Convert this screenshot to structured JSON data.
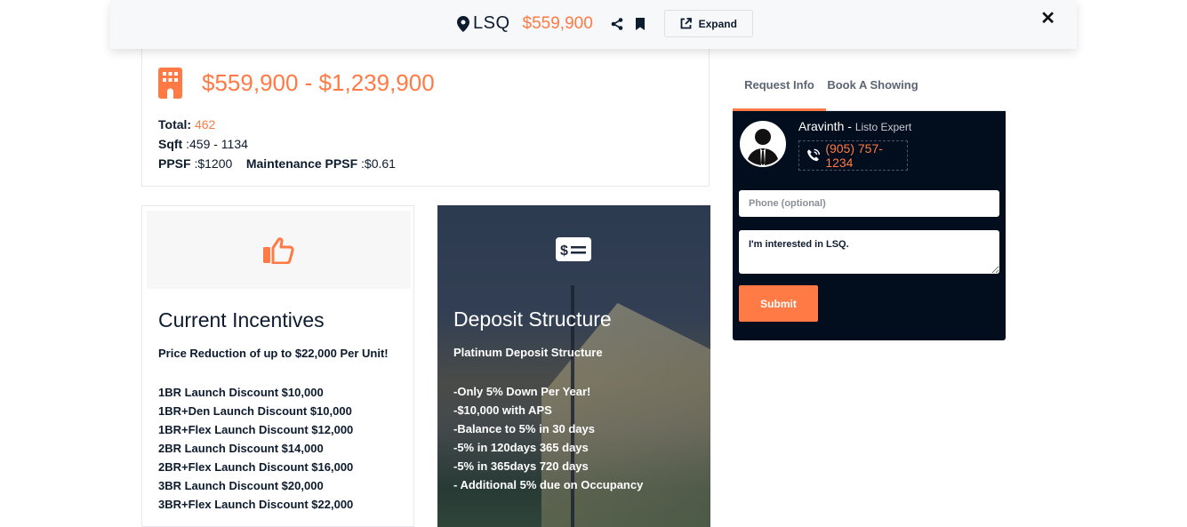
{
  "header": {
    "title": "LSQ",
    "price": "$559,900",
    "expand_label": "Expand",
    "icons": {
      "location": "map-pin-icon",
      "share": "share-icon",
      "bookmark": "bookmark-icon",
      "expand": "external-link-icon",
      "close": "close-icon"
    },
    "close_glyph": "✕"
  },
  "summary": {
    "price_range": "$559,900 - $1,239,900",
    "total_label": "Total:",
    "total_value": "462",
    "sqft_label": "Sqft",
    "sqft_value": ":459 - 1134",
    "ppsf_label": "PPSF",
    "ppsf_value": ":$1200",
    "maint_label": "Maintenance PPSF",
    "maint_value": ":$0.61"
  },
  "incentives": {
    "title": "Current Incentives",
    "subtitle": "Price Reduction of up to $22,000 Per Unit!",
    "items": [
      "1BR Launch Discount $10,000",
      "1BR+Den Launch Discount $10,000",
      "1BR+Flex Launch Discount $12,000",
      "2BR Launch Discount $14,000",
      "2BR+Flex Launch Discount $16,000",
      "3BR Launch Discount $20,000",
      "3BR+Flex Launch Discount $22,000"
    ]
  },
  "deposit": {
    "title": "Deposit Structure",
    "subtitle": "Platinum Deposit Structure",
    "items": [
      "-Only 5% Down Per Year!",
      "-$10,000 with APS",
      "-Balance to 5% in 30 days",
      "-5% in 120days 365 days",
      "-5% in 365days 720 days",
      "- Additional 5% due on Occupancy"
    ]
  },
  "sidebar": {
    "tabs": [
      {
        "label": "Request Info",
        "active": true
      },
      {
        "label": "Book A Showing",
        "active": false
      }
    ],
    "agent_name": "Aravinth -",
    "agent_role": "Listo Expert",
    "agent_phone": "(905) 757-1234",
    "phone_placeholder": "Phone (optional)",
    "message_value": "I'm interested in LSQ.",
    "submit_label": "Submit"
  },
  "colors": {
    "accent": "#ff7a45",
    "panel": "#020d1d",
    "text": "#0d1b2e"
  }
}
